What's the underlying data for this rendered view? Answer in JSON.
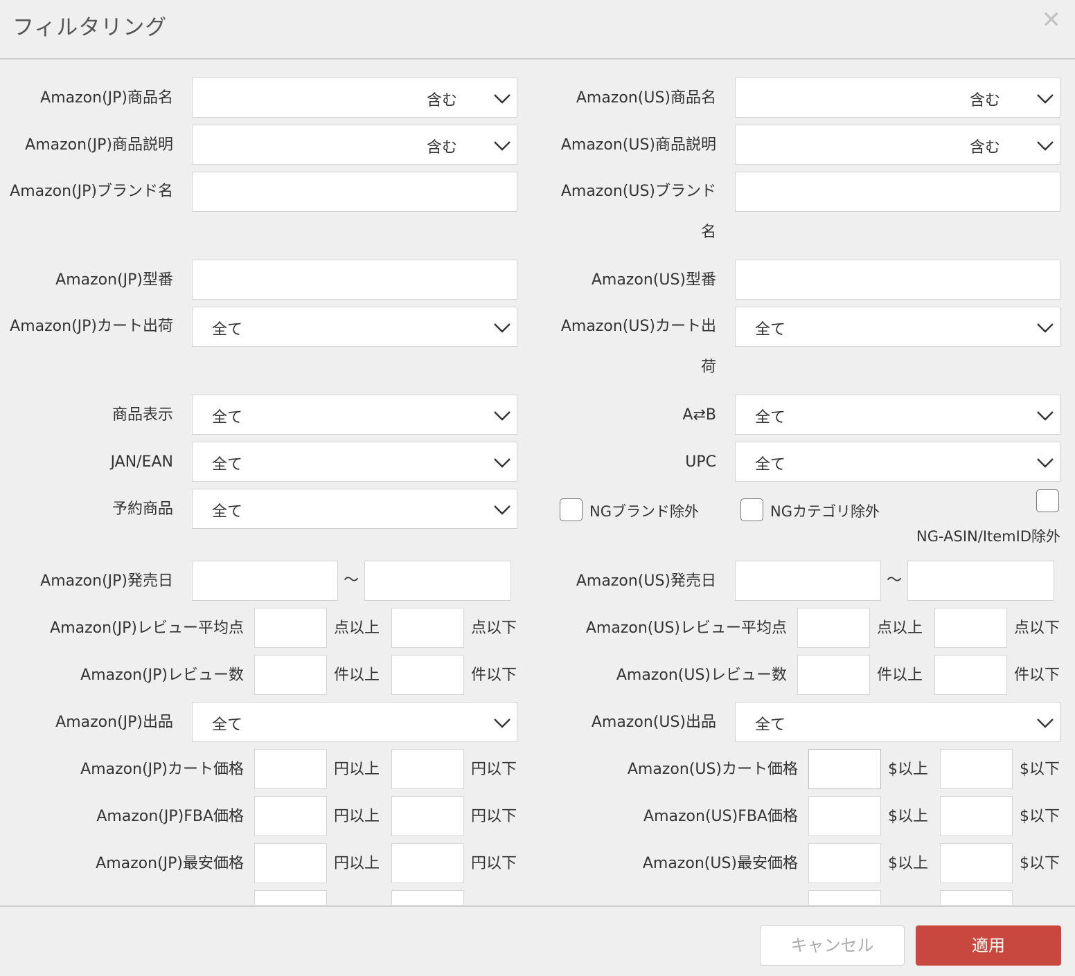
{
  "dialog": {
    "title": "フィルタリング",
    "close_icon": "close-icon",
    "cancel_label": "キャンセル",
    "apply_label": "適用",
    "apply_color": "#c8473e"
  },
  "jp": {
    "product_name": {
      "label": "Amazon(JP)商品名",
      "value": "",
      "match": "含む"
    },
    "product_desc": {
      "label": "Amazon(JP)商品説明",
      "value": "",
      "match": "含む"
    },
    "brand": {
      "label": "Amazon(JP)ブランド名",
      "value": ""
    },
    "model": {
      "label": "Amazon(JP)型番",
      "value": ""
    },
    "cart_ship": {
      "label": "Amazon(JP)カート出荷",
      "value": "全て"
    },
    "release": {
      "label": "Amazon(JP)発売日",
      "separator": "〜",
      "from": "",
      "to": ""
    },
    "review_avg": {
      "label": "Amazon(JP)レビュー平均点",
      "min_unit": "点以上",
      "max_unit": "点以下"
    },
    "review_count": {
      "label": "Amazon(JP)レビュー数",
      "min_unit": "件以上",
      "max_unit": "件以下"
    },
    "listing": {
      "label": "Amazon(JP)出品",
      "value": "全て"
    },
    "cart_price": {
      "label": "Amazon(JP)カート価格",
      "min_unit": "円以上",
      "max_unit": "円以下"
    },
    "fba_price": {
      "label": "Amazon(JP)FBA価格",
      "min_unit": "円以上",
      "max_unit": "円以下"
    },
    "lowest_price": {
      "label": "Amazon(JP)最安価格",
      "min_unit": "円以上",
      "max_unit": "円以下"
    }
  },
  "us": {
    "product_name": {
      "label": "Amazon(US)商品名",
      "value": "",
      "match": "含む"
    },
    "product_desc": {
      "label": "Amazon(US)商品説明",
      "value": "",
      "match": "含む"
    },
    "brand": {
      "label": "Amazon(US)ブランド名",
      "value": ""
    },
    "model": {
      "label": "Amazon(US)型番",
      "value": ""
    },
    "cart_ship": {
      "label": "Amazon(US)カート出荷",
      "value": "全て"
    },
    "release": {
      "label": "Amazon(US)発売日",
      "separator": "〜",
      "from": "",
      "to": ""
    },
    "review_avg": {
      "label": "Amazon(US)レビュー平均点",
      "min_unit": "点以上",
      "max_unit": "点以下"
    },
    "review_count": {
      "label": "Amazon(US)レビュー数",
      "min_unit": "件以上",
      "max_unit": "件以下"
    },
    "listing": {
      "label": "Amazon(US)出品",
      "value": "全て"
    },
    "cart_price": {
      "label": "Amazon(US)カート価格",
      "min_unit": "$以上",
      "max_unit": "$以下"
    },
    "fba_price": {
      "label": "Amazon(US)FBA価格",
      "min_unit": "$以上",
      "max_unit": "$以下"
    },
    "lowest_price": {
      "label": "Amazon(US)最安価格",
      "min_unit": "$以上",
      "max_unit": "$以下"
    }
  },
  "misc": {
    "product_display": {
      "label": "商品表示",
      "value": "全て"
    },
    "a_to_b": {
      "label": "A⇄B",
      "value": "全て"
    },
    "jan_ean": {
      "label": "JAN/EAN",
      "value": "全て"
    },
    "upc": {
      "label": "UPC",
      "value": "全て"
    },
    "reserved": {
      "label": "予約商品",
      "value": "全て"
    },
    "ng_brand": {
      "label": "NGブランド除外",
      "checked": false
    },
    "ng_category": {
      "label": "NGカテゴリ除外",
      "checked": false
    },
    "ng_asin": {
      "label": "NG-ASIN/ItemID除外",
      "checked": false
    }
  }
}
